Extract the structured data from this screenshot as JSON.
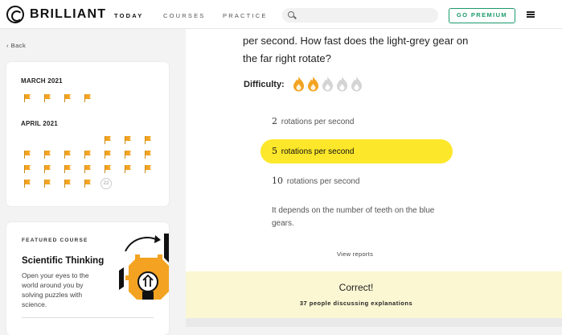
{
  "brand": {
    "name": "BRILLIANT"
  },
  "nav": {
    "items": [
      {
        "label": "TODAY",
        "active": true
      },
      {
        "label": "COURSES",
        "active": false
      },
      {
        "label": "PRACTICE",
        "active": false
      }
    ]
  },
  "search": {
    "placeholder": ""
  },
  "premium_label": "GO PREMIUM",
  "back_label": "Back",
  "streak": {
    "months": [
      {
        "label": "MARCH 2021",
        "completed_days": 4
      },
      {
        "label": "APRIL 2021",
        "completed_days": 21,
        "today": "22"
      }
    ]
  },
  "featured": {
    "label": "FEATURED COURSE",
    "title": "Scientific Thinking",
    "description": "Open your eyes to the world around you by solving puzzles with science."
  },
  "question": {
    "text": "per second. How fast does the light-grey gear on the far right rotate?",
    "difficulty_label": "Difficulty:",
    "difficulty_level": 2,
    "difficulty_max": 5
  },
  "options": [
    {
      "num": "2",
      "text": "rotations per second",
      "selected": false
    },
    {
      "num": "5",
      "text": "rotations per second",
      "selected": true
    },
    {
      "num": "10",
      "text": "rotations per second",
      "selected": false
    },
    {
      "num": "",
      "text": "It depends on the number of teeth on the blue gears.",
      "selected": false
    }
  ],
  "view_reports": "View reports",
  "result": {
    "status": "Correct!",
    "discussion": "37 people discussing explanations"
  },
  "colors": {
    "accent": "#fde72a",
    "premium": "#1c9a6a",
    "flag": "#f3a321",
    "result_bg": "#fbf7d3"
  }
}
